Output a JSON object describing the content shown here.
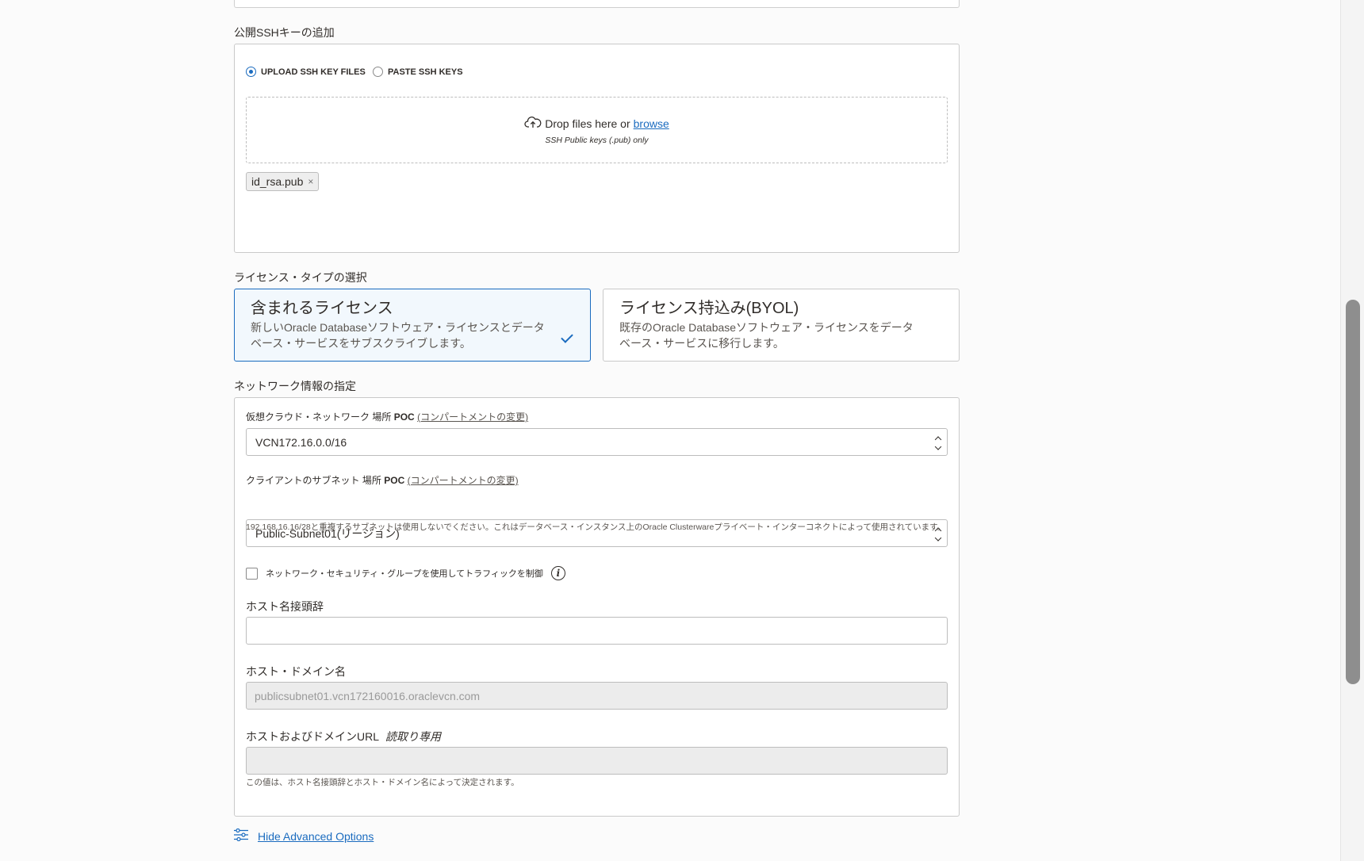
{
  "ssh": {
    "section_label": "公開SSHキーの追加",
    "option_upload": "UPLOAD SSH KEY FILES",
    "option_paste": "PASTE SSH KEYS",
    "selected": "upload",
    "drop_text": "Drop files here or",
    "browse_link": "browse",
    "drop_hint": "SSH Public keys (.pub) only",
    "uploaded_file": "id_rsa.pub",
    "remove_symbol": "×"
  },
  "license": {
    "section_label": "ライセンス・タイプの選択",
    "options": [
      {
        "title": "含まれるライセンス",
        "description": "新しいOracle Databaseソフトウェア・ライセンスとデータベース・サービスをサブスクライブします。",
        "selected": true
      },
      {
        "title": "ライセンス持込み(BYOL)",
        "description": "既存のOracle Databaseソフトウェア・ライセンスをデータベース・サービスに移行します。",
        "selected": false
      }
    ]
  },
  "network": {
    "section_label": "ネットワーク情報の指定",
    "vcn_label": "仮想クラウド・ネットワーク",
    "vcn_location_prefix": "場所",
    "vcn_compartment": "POC",
    "vcn_change_link": "(コンパートメントの変更)",
    "vcn_value": "VCN172.16.0.0/16",
    "subnet_label": "クライアントのサブネット",
    "subnet_location_prefix": "場所",
    "subnet_compartment": "POC",
    "subnet_change_link": "(コンパートメントの変更)",
    "subnet_value": "Public-Subnet01(リージョン)",
    "subnet_help": "192.168.16.16/28と重複するサブネットは使用しないでください。これはデータベース・インスタンス上のOracle Clusterwareプライベート・インターコネクトによって使用されています。",
    "nsg_checkbox_label": "ネットワーク・セキュリティ・グループを使用してトラフィックを制御",
    "nsg_checked": false,
    "info_symbol": "i",
    "hostname_prefix_label": "ホスト名接頭辞",
    "hostname_prefix_value": "",
    "host_domain_label": "ホスト・ドメイン名",
    "host_domain_value": "publicsubnet01.vcn172160016.oraclevcn.com",
    "host_url_label": "ホストおよびドメインURL",
    "host_url_readonly": "読取り専用",
    "host_url_value": "",
    "host_url_help": "この値は、ホスト名接頭辞とホスト・ドメイン名によって決定されます。"
  },
  "advanced": {
    "toggle_label": "Hide Advanced Options"
  },
  "colors": {
    "accent": "#1a6bbf",
    "selected_card_bg": "#f2f8fd",
    "text": "#312d2a"
  }
}
